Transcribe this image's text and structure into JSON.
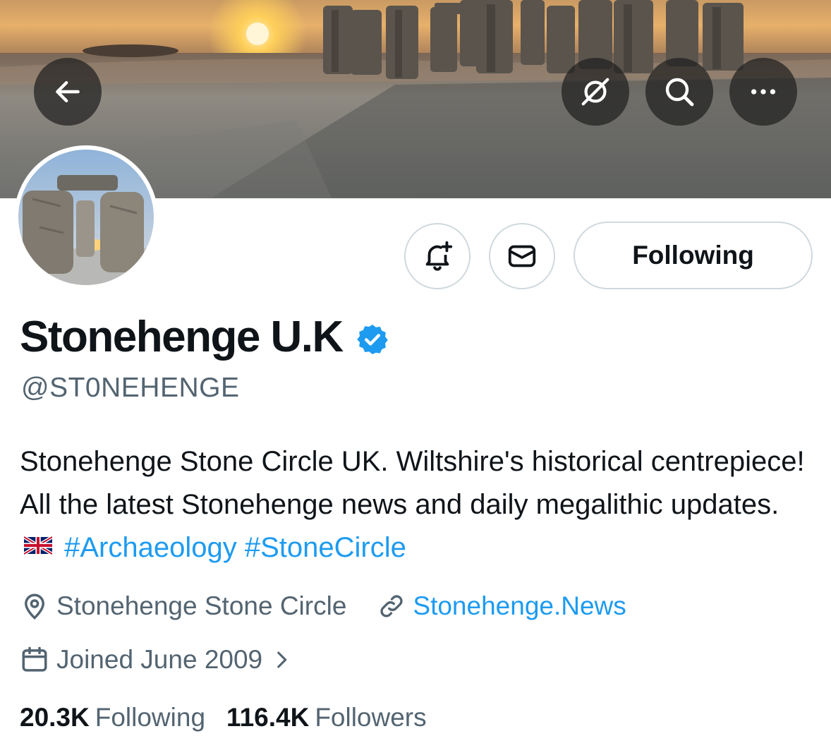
{
  "header": {
    "back_icon": "arrow-left-icon",
    "grok_icon": "grok-slash-icon",
    "search_icon": "search-icon",
    "more_icon": "more-horizontal-icon"
  },
  "profile": {
    "display_name": "Stonehenge U.K",
    "verified": true,
    "handle": "@ST0NEHENGE",
    "bio": {
      "text": "Stonehenge Stone Circle UK. Wiltshire's historical centrepiece! All the latest Stonehenge news and daily megalithic updates.",
      "flag": "uk-flag-emoji",
      "hashtags": [
        "#Archaeology",
        "#StoneCircle"
      ]
    },
    "location": "Stonehenge Stone Circle",
    "website": "Stonehenge.News",
    "joined": "Joined June 2009"
  },
  "actions": {
    "notify_icon": "bell-plus-icon",
    "message_icon": "envelope-icon",
    "following_label": "Following"
  },
  "stats": {
    "following_count": "20.3K",
    "following_label": "Following",
    "followers_count": "116.4K",
    "followers_label": "Followers"
  },
  "colors": {
    "link": "#1d9bf0",
    "secondary_text": "#536471",
    "primary_text": "#0f1419",
    "border": "#cfd9de"
  }
}
